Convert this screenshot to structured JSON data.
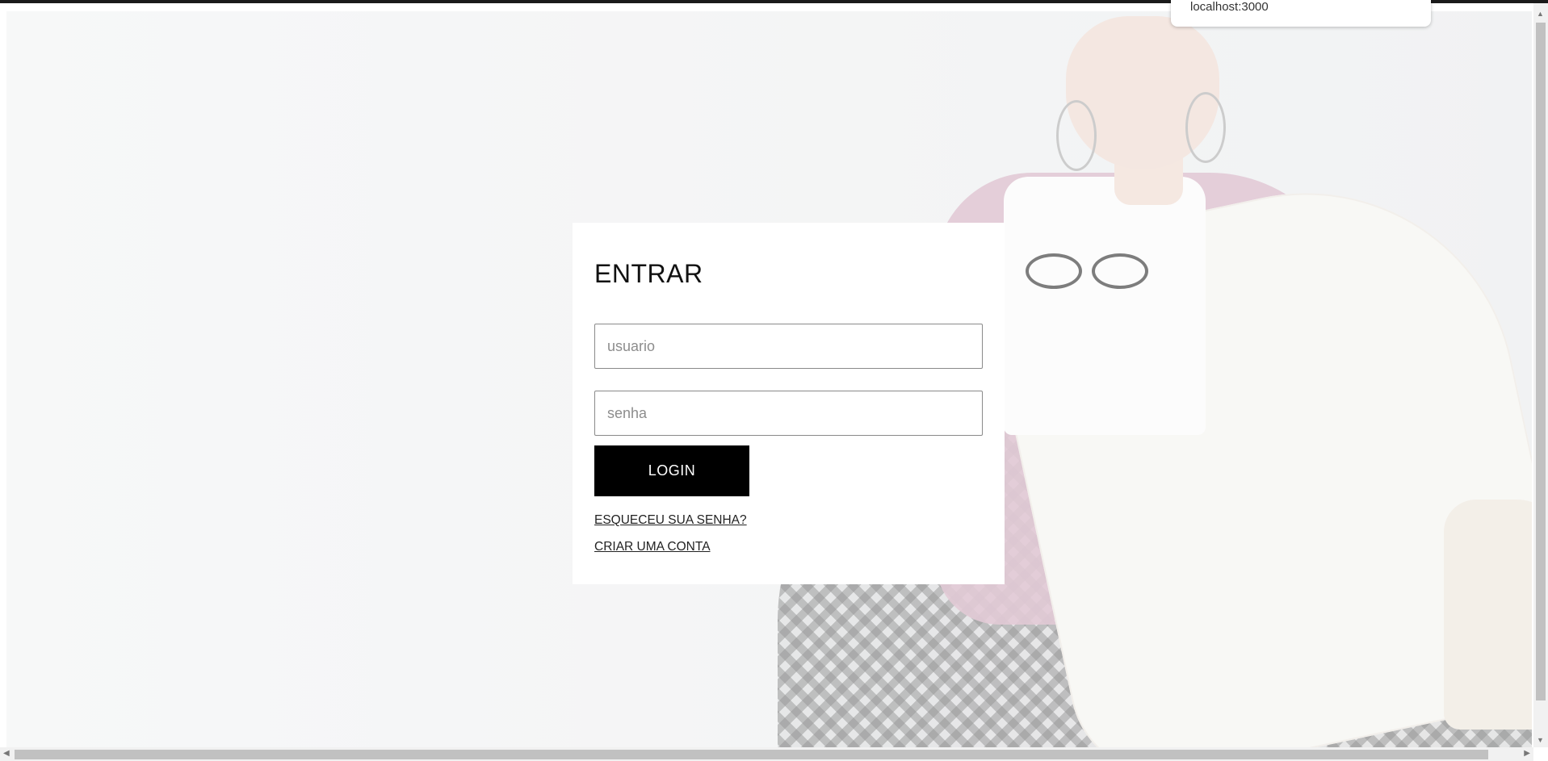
{
  "browser": {
    "status_url": "localhost:3000"
  },
  "login": {
    "title": "ENTRAR",
    "username_placeholder": "usuario",
    "password_placeholder": "senha",
    "login_button": "LOGIN",
    "forgot_password_link": "ESQUECEU SUA SENHA?",
    "create_account_link": "CRIAR UMA CONTA"
  },
  "scrollbars": {
    "up_arrow": "▲",
    "down_arrow": "▼",
    "left_arrow": "◀",
    "right_arrow": "▶"
  },
  "colors": {
    "button_bg": "#000000",
    "card_bg": "#ffffff",
    "jacket": "#d7b6c6"
  }
}
